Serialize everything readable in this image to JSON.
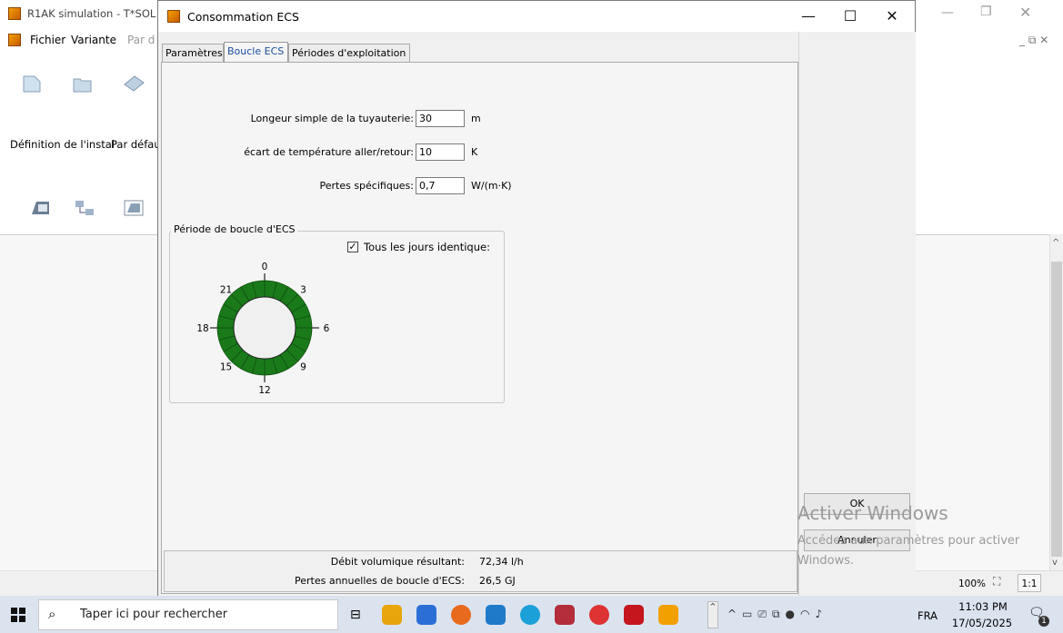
{
  "background_app": {
    "title": "R1AK simulation - T*SOL",
    "menu": [
      "Fichier",
      "Variante",
      "Par d"
    ],
    "toolbar_labels": [
      "Définition de l'instal",
      "Par défau"
    ],
    "status": {
      "zoom": "100%",
      "ratio": "1:1"
    }
  },
  "dialog": {
    "title": "Consommation ECS",
    "controls": {
      "minimize": "—",
      "maximize": "☐",
      "close": "✕"
    },
    "tabs": [
      {
        "label": "Paramètres",
        "active": false
      },
      {
        "label": "Boucle ECS",
        "active": true
      },
      {
        "label": "Périodes d'exploitation",
        "active": false
      }
    ],
    "fields": [
      {
        "label": "Longeur simple de la tuyauterie:",
        "value": "30",
        "unit": "m"
      },
      {
        "label": "écart de température aller/retour:",
        "value": "10",
        "unit": "K"
      },
      {
        "label": "Pertes spécifiques:",
        "value": "0,7",
        "unit": "W/(m·K)"
      }
    ],
    "loop_period": {
      "group_title": "Période de boucle d'ECS",
      "checkbox_label": "Tous les jours identique:",
      "checkbox_checked": true,
      "active_hours": 24,
      "active_color": "#1a7a1a",
      "hour_labels": [
        "0",
        "3",
        "6",
        "9",
        "12",
        "15",
        "18",
        "21"
      ]
    },
    "results": [
      {
        "label": "Débit volumique résultant:",
        "value": "72,34 l/h"
      },
      {
        "label": "Pertes annuelles de boucle d'ECS:",
        "value": "26,5 GJ"
      }
    ],
    "buttons": {
      "ok": "OK",
      "cancel": "Annuler"
    }
  },
  "watermark": {
    "line1": "Activer Windows",
    "line2": "Accédez aux paramètres pour activer",
    "line3": "Windows."
  },
  "taskbar": {
    "search_placeholder": "Taper ici pour rechercher",
    "language": "FRA",
    "time": "11:03 PM",
    "date": "17/05/2025",
    "notification_count": "1"
  }
}
